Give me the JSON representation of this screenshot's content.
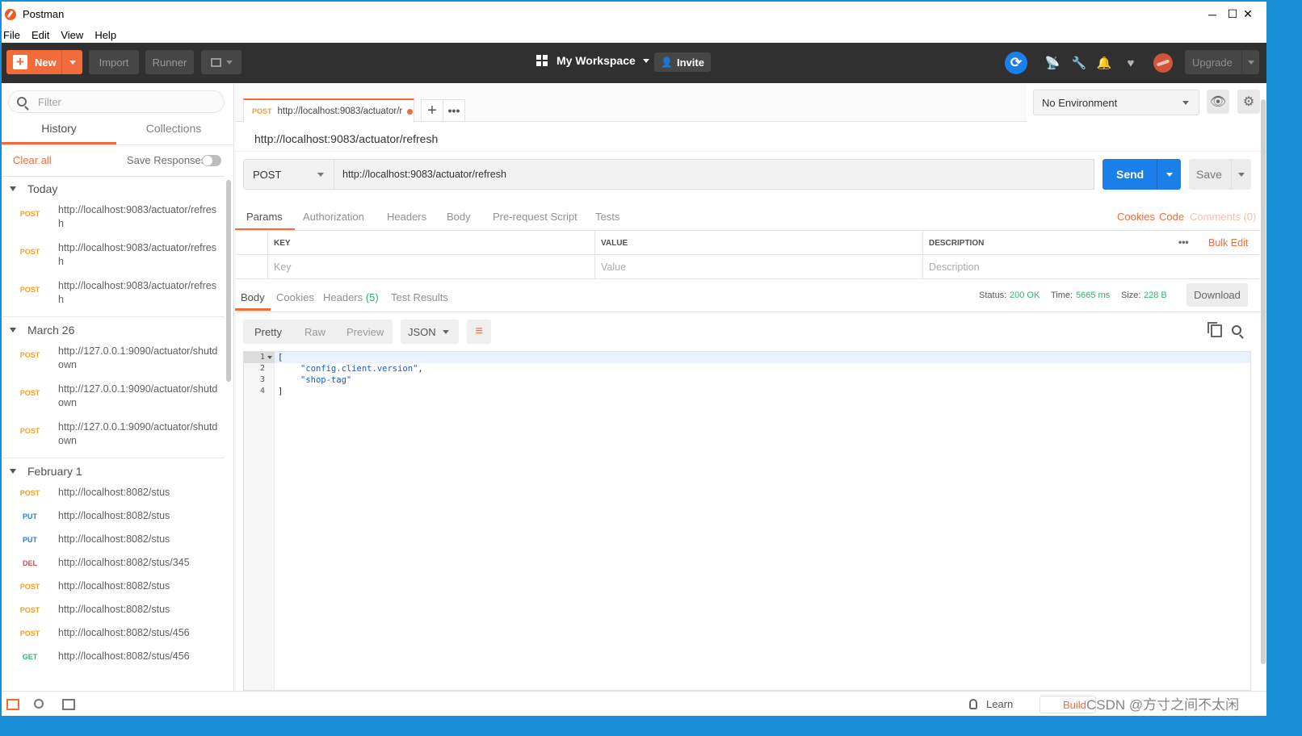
{
  "window": {
    "title": "Postman",
    "controls": {
      "minimize": "─",
      "maximize": "☐",
      "close": "✕"
    }
  },
  "menu": [
    "File",
    "Edit",
    "View",
    "Help"
  ],
  "header": {
    "new_label": "New",
    "import_label": "Import",
    "runner_label": "Runner",
    "workspace_label": "My Workspace",
    "invite_label": "Invite",
    "upgrade_label": "Upgrade"
  },
  "sidebar": {
    "filter_placeholder": "Filter",
    "tabs": [
      "History",
      "Collections"
    ],
    "clear_all": "Clear all",
    "save_responses": "Save Responses",
    "groups": [
      {
        "label": "Today",
        "items": [
          {
            "method": "POST",
            "url": "http://localhost:9083/actuator/refresh"
          },
          {
            "method": "POST",
            "url": "http://localhost:9083/actuator/refresh"
          },
          {
            "method": "POST",
            "url": "http://localhost:9083/actuator/refresh"
          }
        ]
      },
      {
        "label": "March 26",
        "items": [
          {
            "method": "POST",
            "url": "http://127.0.0.1:9090/actuator/shutdown"
          },
          {
            "method": "POST",
            "url": "http://127.0.0.1:9090/actuator/shutdown"
          },
          {
            "method": "POST",
            "url": "http://127.0.0.1:9090/actuator/shutdown"
          }
        ]
      },
      {
        "label": "February 1",
        "items": [
          {
            "method": "POST",
            "url": "http://localhost:8082/stus"
          },
          {
            "method": "PUT",
            "url": "http://localhost:8082/stus"
          },
          {
            "method": "PUT",
            "url": "http://localhost:8082/stus"
          },
          {
            "method": "DEL",
            "url": "http://localhost:8082/stus/345"
          },
          {
            "method": "POST",
            "url": "http://localhost:8082/stus"
          },
          {
            "method": "POST",
            "url": "http://localhost:8082/stus"
          },
          {
            "method": "POST",
            "url": "http://localhost:8082/stus/456"
          },
          {
            "method": "GET",
            "url": "http://localhost:8082/stus/456"
          }
        ]
      }
    ]
  },
  "method_colors": {
    "POST": "#f2a026",
    "PUT": "#1a7fe8",
    "DEL": "#e8453c",
    "GET": "#2fb36d"
  },
  "request_tab": {
    "method": "POST",
    "url": "http://localhost:9083/actuator/r"
  },
  "environment": {
    "selected": "No Environment"
  },
  "request": {
    "name": "http://localhost:9083/actuator/refresh",
    "method": "POST",
    "url": "http://localhost:9083/actuator/refresh",
    "send_label": "Send",
    "save_label": "Save",
    "tabs": [
      "Params",
      "Authorization",
      "Headers",
      "Body",
      "Pre-request Script",
      "Tests"
    ],
    "links": {
      "cookies": "Cookies",
      "code": "Code",
      "comments": "Comments (0)"
    },
    "params": {
      "headers": {
        "key": "KEY",
        "value": "VALUE",
        "description": "DESCRIPTION"
      },
      "bulk_edit": "Bulk Edit",
      "more": "•••",
      "placeholders": {
        "key": "Key",
        "value": "Value",
        "description": "Description"
      }
    }
  },
  "response": {
    "tabs": {
      "body": "Body",
      "cookies": "Cookies",
      "headers": "Headers",
      "headers_count": "(5)",
      "tests": "Test Results"
    },
    "status_label": "Status:",
    "status": "200 OK",
    "time_label": "Time:",
    "time": "5665 ms",
    "size_label": "Size:",
    "size": "228 B",
    "download": "Download",
    "formats": [
      "Pretty",
      "Raw",
      "Preview"
    ],
    "language": "JSON",
    "lines": [
      "1",
      "2",
      "3",
      "4"
    ],
    "code": {
      "open": "[",
      "item1": "\"config.client.version\"",
      "item1_tail": ",",
      "item2": "\"shop-tag\"",
      "close": "]"
    }
  },
  "footer": {
    "learn": "Learn",
    "build": "Build"
  },
  "watermark": "CSDN @方寸之间不太闲"
}
